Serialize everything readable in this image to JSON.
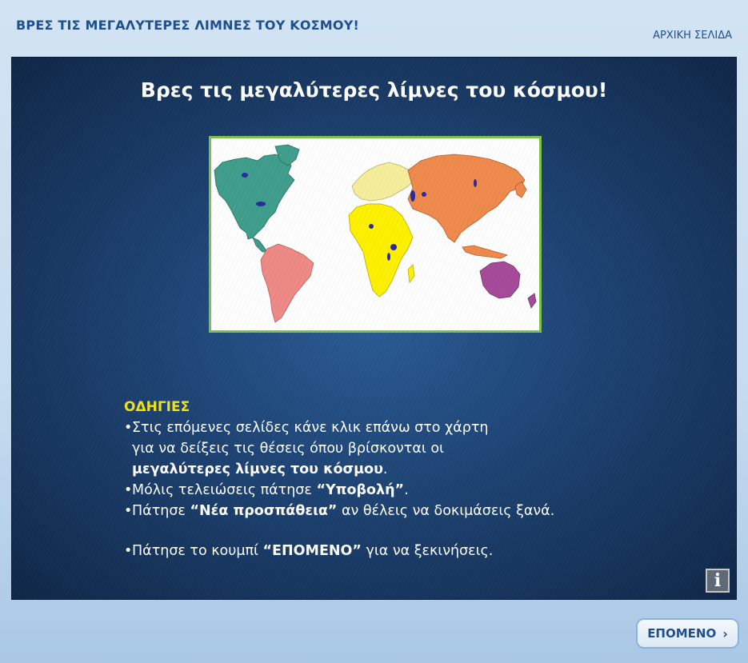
{
  "header": {
    "title": "ΒΡΕΣ ΤΙΣ ΜΕΓΑΛΥΤΕΡΕΣ ΛΙΜΝΕΣ ΤΟΥ ΚΟΣΜΟΥ!",
    "home_link": "ΑΡΧΙΚΗ ΣΕΛΙΔΑ"
  },
  "stage": {
    "headline": "Βρες τις μεγαλύτερες λίμνες του κόσμου!",
    "map": {
      "colors": {
        "north_america": "#3f9e8c",
        "south_america": "#f08a86",
        "europe": "#f6ef9c",
        "africa": "#fff200",
        "asia": "#f08a4b",
        "australia": "#a74a9a",
        "lakes": "#2a2a9e",
        "frame": "#7cc24a"
      }
    },
    "instructions": {
      "heading": "ΟΔΗΓΙΕΣ",
      "b1_l1": "Στις επόμενες σελίδες κάνε κλικ επάνω στο χάρτη",
      "b1_l2": "για να δείξεις τις θέσεις όπου βρίσκονται οι",
      "b1_l3_bold": "μεγαλύτερες λίμνες του κόσμου",
      "b1_l3_end": ".",
      "b2_pre": "Μόλις τελειώσεις πάτησε ",
      "b2_bold": "“Υποβολή”",
      "b2_end": ".",
      "b3_pre": "Πάτησε ",
      "b3_bold": "“Νέα προσπάθεια”",
      "b3_post": " αν θέλεις να δοκιμάσεις ξανά.",
      "b4_pre": "Πάτησε το κουμπί ",
      "b4_bold": "“ΕΠΟΜΕΝΟ”",
      "b4_post": " για να ξεκινήσεις.",
      "bullet": "•"
    },
    "info_icon": "i"
  },
  "footer": {
    "next_label": "ΕΠΟΜΕΝΟ",
    "next_icon": "›"
  }
}
